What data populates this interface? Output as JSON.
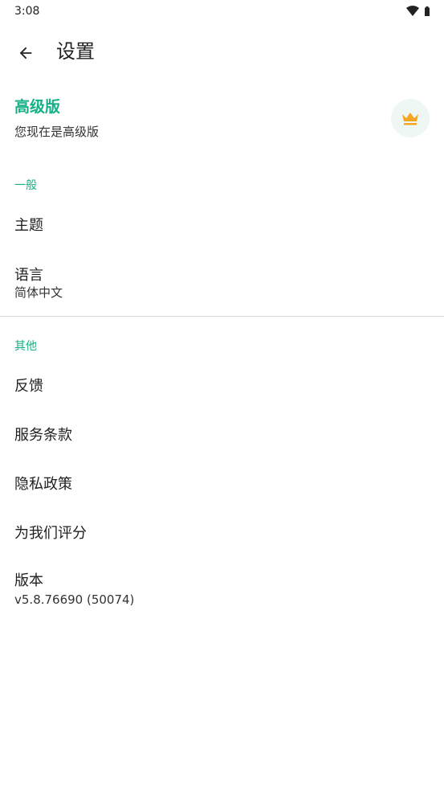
{
  "status_bar": {
    "time": "3:08",
    "wifi_icon": "wifi-icon",
    "battery_icon": "battery-icon"
  },
  "toolbar": {
    "back_icon": "arrow-left-icon",
    "title": "设置"
  },
  "premium": {
    "title": "高级版",
    "subtitle": "您现在是高级版",
    "icon": "crown-icon",
    "accent_color": "#16b086",
    "crown_color": "#f5a623"
  },
  "sections": {
    "general": {
      "header": "一般",
      "theme_label": "主题",
      "language_label": "语言",
      "language_value": "简体中文"
    },
    "other": {
      "header": "其他",
      "feedback_label": "反馈",
      "terms_label": "服务条款",
      "privacy_label": "隐私政策",
      "rate_label": "为我们评分",
      "version_label": "版本",
      "version_value": "v5.8.76690 (50074)"
    }
  }
}
